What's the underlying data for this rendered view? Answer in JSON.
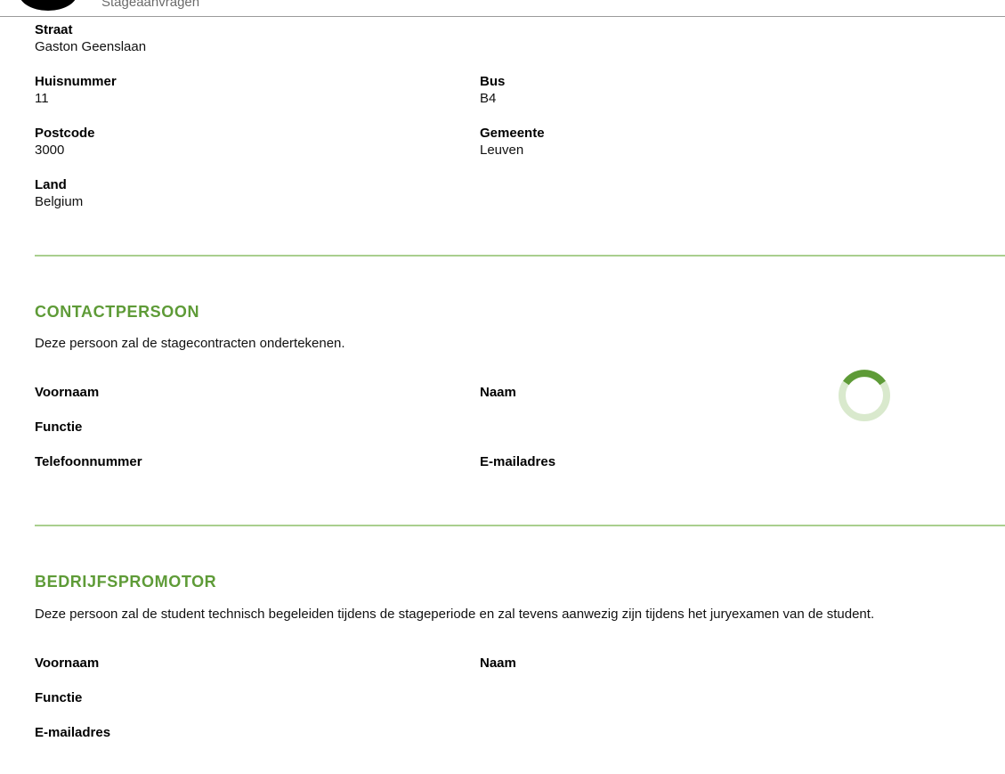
{
  "header": {
    "subtitle": "Stageaanvragen"
  },
  "address": {
    "street_label": "Straat",
    "street_value": "Gaston Geenslaan",
    "number_label": "Huisnummer",
    "number_value": "11",
    "bus_label": "Bus",
    "bus_value": "B4",
    "postcode_label": "Postcode",
    "postcode_value": "3000",
    "city_label": "Gemeente",
    "city_value": "Leuven",
    "country_label": "Land",
    "country_value": "Belgium"
  },
  "contact": {
    "title": "CONTACTPERSOON",
    "description": "Deze persoon zal de stagecontracten ondertekenen.",
    "firstname_label": "Voornaam",
    "lastname_label": "Naam",
    "function_label": "Functie",
    "phone_label": "Telefoonnummer",
    "email_label": "E-mailadres"
  },
  "promotor": {
    "title": "BEDRIJFSPROMOTOR",
    "description": "Deze persoon zal de student technisch begeleiden tijdens de stageperiode en zal tevens aanwezig zijn tijdens het juryexamen van de student.",
    "firstname_label": "Voornaam",
    "lastname_label": "Naam",
    "function_label": "Functie",
    "email_label": "E-mailadres"
  },
  "colors": {
    "accent": "#5e9b37",
    "divider": "#a9cf8e",
    "spinner_track": "#d9e9cd"
  },
  "icons": {
    "spinner": "loading-spinner-icon"
  }
}
